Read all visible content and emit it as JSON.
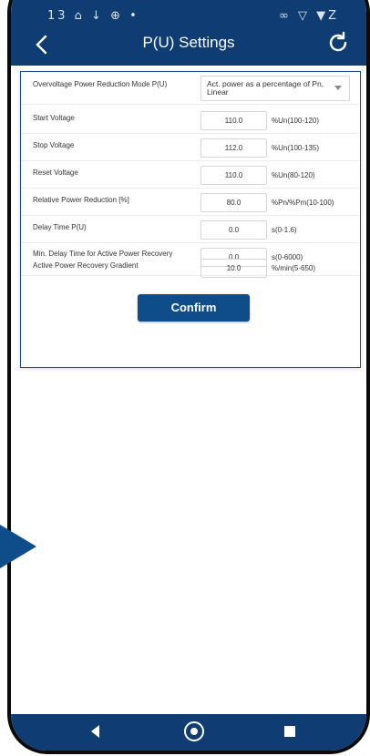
{
  "status_bar": {
    "left": "13 ⌂ ↓ ⊕ •",
    "right": "∞ ▽ ▼Z"
  },
  "header": {
    "title": "P(U) Settings"
  },
  "settings": [
    {
      "label": "Overvoltage Power Reduction Mode P(U)",
      "select": "Act. power as a percentage of Pn, Linear"
    },
    {
      "label": "Start Voltage",
      "value": "110.0",
      "unit": "%Un(100-120)"
    },
    {
      "label": "Stop Voltage",
      "value": "112.0",
      "unit": "%Un(100-135)"
    },
    {
      "label": "Reset Voltage",
      "value": "110.0",
      "unit": "%Un(80-120)"
    },
    {
      "label": "Relative Power Reduction [%]",
      "value": "80.0",
      "unit": "%Pn/%Pm(10-100)"
    },
    {
      "label": "Delay Time P(U)",
      "value": "0.0",
      "unit": "s(0-1.6)"
    },
    {
      "label": "Min. Delay Time for Active Power Recovery",
      "value": "0.0",
      "unit": "s(0-6000)"
    },
    {
      "label": "Active Power Recovery Gradient",
      "value": "10.0",
      "unit": "%/min(5-650)"
    }
  ],
  "confirm_label": "Confirm",
  "colors": {
    "header": "#0f3d73",
    "button": "#0f4c8a",
    "card_border": "#1b4f8c"
  },
  "icons": [
    "back-icon",
    "refresh-icon",
    "dropdown-arrow-icon",
    "nav-back-icon",
    "nav-home-icon",
    "nav-recent-icon",
    "pointer-arrow-icon"
  ]
}
